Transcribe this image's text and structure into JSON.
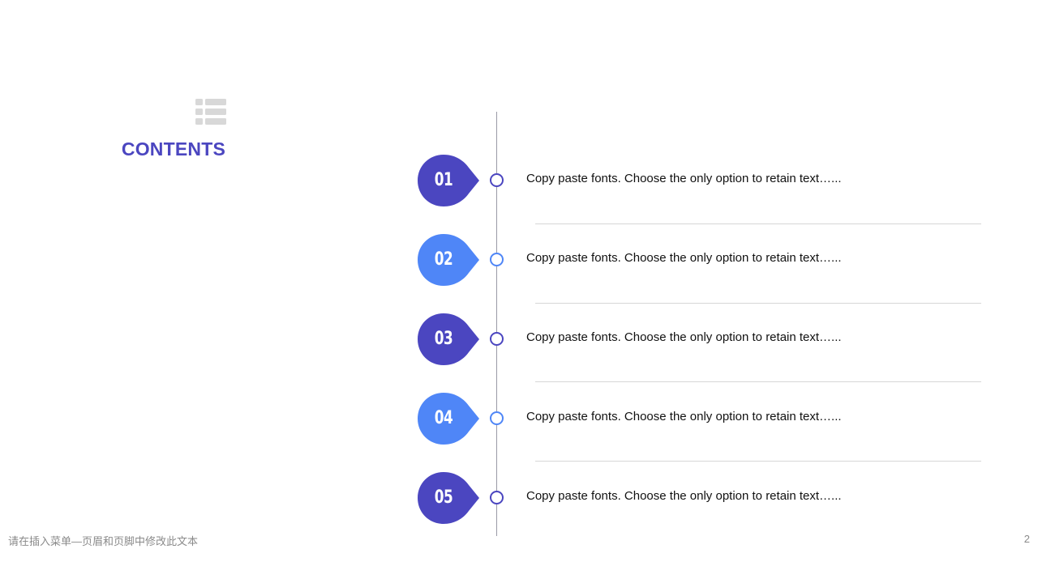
{
  "header": {
    "icon": "list-icon",
    "title": "CONTENTS"
  },
  "colors": {
    "primary": "#4b46c0",
    "secondary": "#4f86f7",
    "timeline": "#9a9aa6",
    "separator": "#d6d6d6"
  },
  "items": [
    {
      "number": "01",
      "text": "Copy paste fonts. Choose the only option to retain text…...",
      "color": "#4b46c0"
    },
    {
      "number": "02",
      "text": "Copy paste fonts. Choose the only option to retain text…...",
      "color": "#4f86f7"
    },
    {
      "number": "03",
      "text": "Copy paste fonts. Choose the only option to retain text…...",
      "color": "#4b46c0"
    },
    {
      "number": "04",
      "text": "Copy paste fonts. Choose the only option to retain text…...",
      "color": "#4f86f7"
    },
    {
      "number": "05",
      "text": "Copy paste fonts. Choose the only option to retain text…...",
      "color": "#4b46c0"
    }
  ],
  "footer": {
    "text": "请在插入菜单—页眉和页脚中修改此文本",
    "page_number": "2"
  }
}
